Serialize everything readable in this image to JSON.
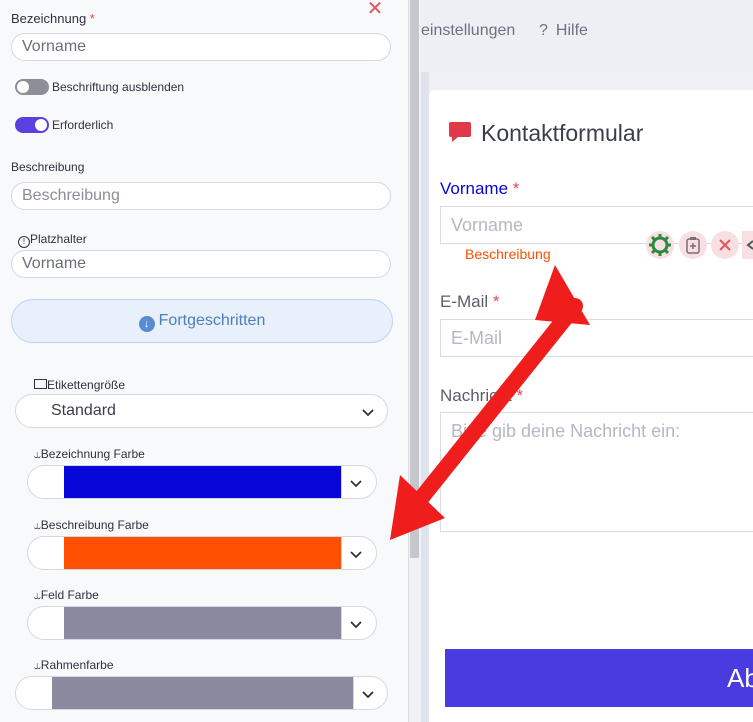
{
  "settings_panel": {
    "label_field": {
      "label": "Bezeichnung",
      "required_mark": "*",
      "value": "Vorname"
    },
    "hide_label_toggle": {
      "label": "Beschriftung ausblenden",
      "on": false
    },
    "required_toggle": {
      "label": "Erforderlich",
      "on": true
    },
    "description_field": {
      "label": "Beschreibung",
      "placeholder": "Beschreibung"
    },
    "placeholder_field": {
      "label": "Platzhalter",
      "value": "Vorname"
    },
    "advanced_button": "Fortgeschritten",
    "label_size": {
      "label": "Etikettengröße",
      "value": "Standard"
    },
    "color_fields": [
      {
        "label": "Bezeichnung Farbe",
        "color": "#0606d8"
      },
      {
        "label": "Beschreibung Farbe",
        "color": "#fe5000"
      },
      {
        "label": "Feld Farbe",
        "color": "#8a899f"
      },
      {
        "label": "Rahmenfarbe",
        "color": "#8a899f"
      }
    ]
  },
  "top_nav": {
    "settings": "einstellungen",
    "help_icon": "?",
    "help": "Hilfe"
  },
  "form_preview": {
    "title": "Kontaktformular",
    "fields": [
      {
        "label": "Vorname",
        "required_mark": "*",
        "placeholder": "Vorname",
        "description": "Beschreibung"
      },
      {
        "label": "E-Mail",
        "required_mark": "*",
        "placeholder": "E-Mail"
      },
      {
        "label": "Nachricht",
        "required_mark": "*",
        "placeholder": "Bitte gib deine Nachricht ein:"
      }
    ],
    "submit_label": "Ab"
  },
  "colors": {
    "accent": "#5b3fe0",
    "arrow": "#f01d1d",
    "label_blue": "#0606d8",
    "description_orange": "#fe5000"
  }
}
